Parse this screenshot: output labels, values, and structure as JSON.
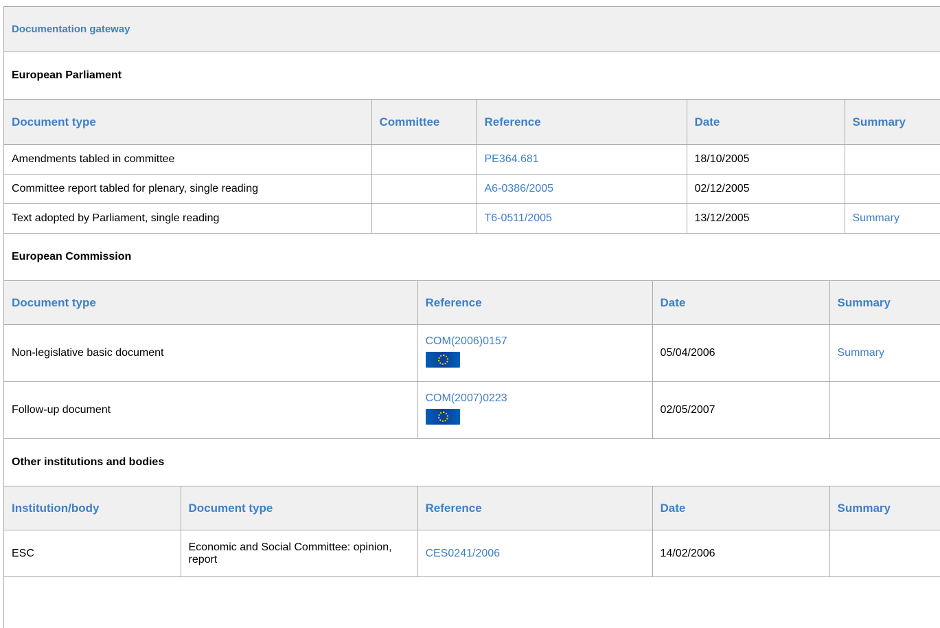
{
  "gateway": {
    "title": "Documentation gateway"
  },
  "ep": {
    "title": "European Parliament",
    "headers": [
      "Document type",
      "Committee",
      "Reference",
      "Date",
      "Summary"
    ],
    "rows": [
      {
        "doc_type": "Amendments tabled in committee",
        "committee": "",
        "reference": "PE364.681",
        "date": "18/10/2005",
        "summary": ""
      },
      {
        "doc_type": "Committee report tabled for plenary, single reading",
        "committee": "",
        "reference": "A6-0386/2005",
        "date": "02/12/2005",
        "summary": ""
      },
      {
        "doc_type": "Text adopted by Parliament, single reading",
        "committee": "",
        "reference": "T6-0511/2005",
        "date": "13/12/2005",
        "summary": "Summary"
      }
    ]
  },
  "ec": {
    "title": "European Commission",
    "headers": [
      "Document type",
      "Reference",
      "Date",
      "Summary"
    ],
    "rows": [
      {
        "doc_type": "Non-legislative basic document",
        "reference": "COM(2006)0157",
        "date": "05/04/2006",
        "summary": "Summary",
        "flag_icon": "eu-flag-icon"
      },
      {
        "doc_type": "Follow-up document",
        "reference": "COM(2007)0223",
        "date": "02/05/2007",
        "summary": "",
        "flag_icon": "eu-flag-icon"
      }
    ]
  },
  "other": {
    "title": "Other institutions and bodies",
    "headers": [
      "Institution/body",
      "Document type",
      "Reference",
      "Date",
      "Summary"
    ],
    "rows": [
      {
        "institution": "ESC",
        "doc_type": "Economic and Social Committee: opinion, report",
        "reference": "CES0241/2006",
        "date": "14/02/2006",
        "summary": ""
      }
    ]
  },
  "colors": {
    "link": "#3f7fc6",
    "header_bg": "#f0f0f0",
    "border": "#a9a9a9"
  }
}
